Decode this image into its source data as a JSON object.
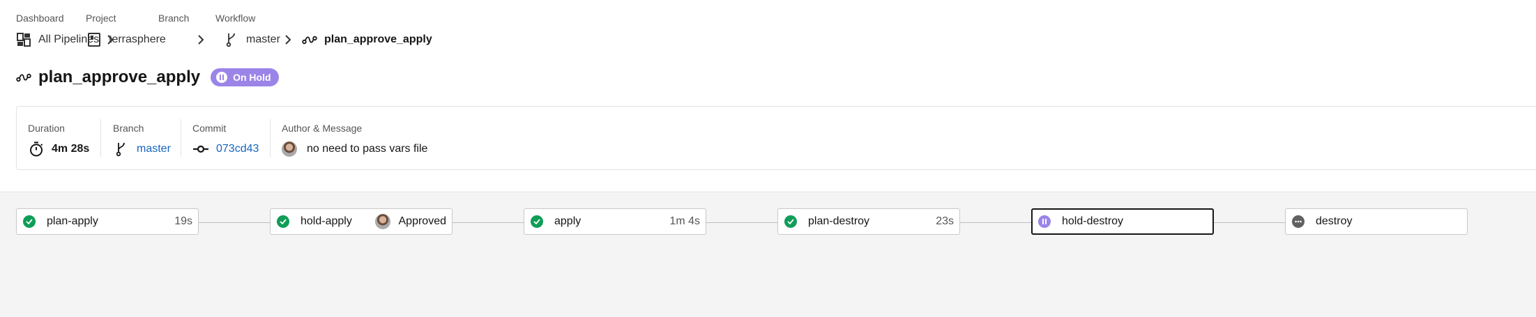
{
  "breadcrumb": {
    "labels": [
      "Dashboard",
      "Project",
      "Branch",
      "Workflow"
    ],
    "items": [
      {
        "text": "All Pipelines",
        "icon": "dashboard-icon"
      },
      {
        "text": "terrasphere",
        "icon": "project-icon"
      },
      {
        "text": "master",
        "icon": "branch-icon"
      },
      {
        "text": "plan_approve_apply",
        "icon": "workflow-icon"
      }
    ]
  },
  "header": {
    "title": "plan_approve_apply",
    "status": "On Hold",
    "status_color": "#9b84e8"
  },
  "info": {
    "duration_label": "Duration",
    "duration": "4m 28s",
    "branch_label": "Branch",
    "branch": "master",
    "commit_label": "Commit",
    "commit": "073cd43",
    "author_label": "Author & Message",
    "message": "no need to pass vars file"
  },
  "colors": {
    "success": "#0f9d58",
    "on_hold": "#9b84e8",
    "blocked": "#616161",
    "link": "#1565c0"
  },
  "jobs": [
    {
      "name": "plan-apply",
      "status": "success",
      "duration": "19s"
    },
    {
      "name": "hold-apply",
      "status": "success",
      "approval": "Approved"
    },
    {
      "name": "apply",
      "status": "success",
      "duration": "1m 4s"
    },
    {
      "name": "plan-destroy",
      "status": "success",
      "duration": "23s"
    },
    {
      "name": "hold-destroy",
      "status": "on_hold"
    },
    {
      "name": "destroy",
      "status": "blocked"
    }
  ]
}
